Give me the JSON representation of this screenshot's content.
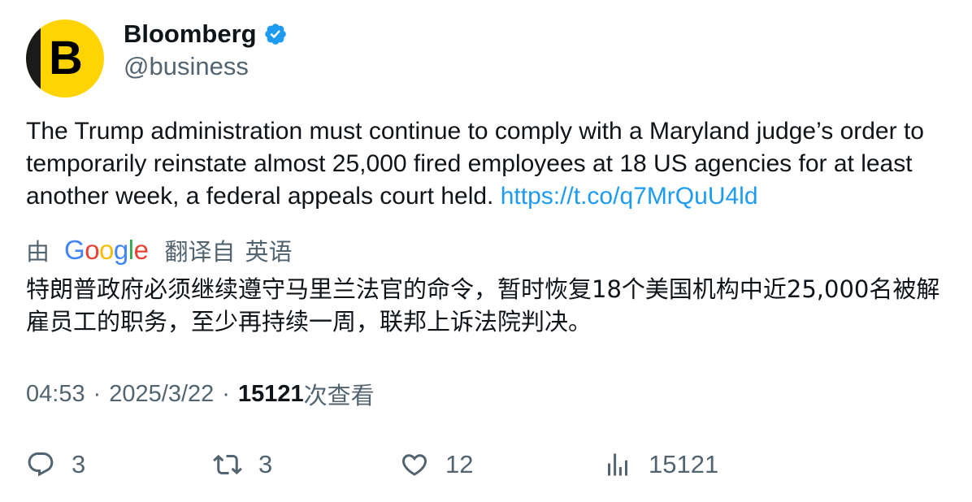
{
  "author": {
    "avatar_letter": "B",
    "display_name": "Bloomberg",
    "verified_icon": "verified-badge-icon",
    "handle": "@business"
  },
  "tweet": {
    "text": "The Trump administration must continue to comply with a Maryland judge’s order to temporarily reinstate almost 25,000 fired employees at 18 US agencies for at least another week, a federal appeals court held. ",
    "link": "https://t.co/q7MrQuU4ld"
  },
  "translation": {
    "by_label": "由",
    "provider_letters": [
      "G",
      "o",
      "o",
      "g",
      "l",
      "e"
    ],
    "translated_from_label": "翻译自",
    "source_language": "英语",
    "text": "特朗普政府必须继续遵守马里兰法官的命令，暂时恢复18个美国机构中近25,000名被解雇员工的职务，至少再持续一周，联邦上诉法院判决。"
  },
  "meta": {
    "time": "04:53",
    "separator": "·",
    "date": "2025/3/22",
    "views_count": "15121",
    "views_label": "次查看"
  },
  "actions": {
    "reply_count": "3",
    "retweet_count": "3",
    "like_count": "12",
    "views_count": "15121"
  },
  "colors": {
    "link": "#1d9bf0",
    "secondary_text": "#536471",
    "verified": "#1d9bf0",
    "avatar_bg": "#ffd400"
  }
}
